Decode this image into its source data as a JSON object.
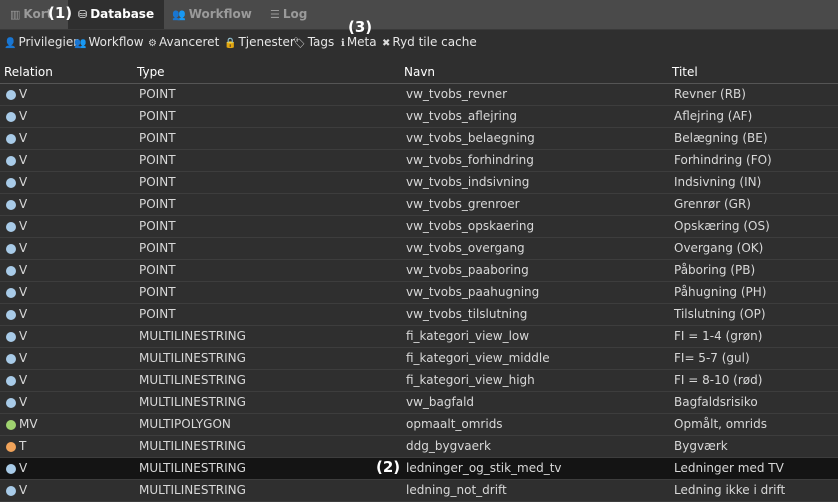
{
  "tabs": [
    {
      "label": "Kort",
      "icon": "map-icon",
      "active": false
    },
    {
      "label": "Database",
      "icon": "database-icon",
      "active": true
    },
    {
      "label": "Workflow",
      "icon": "users-icon",
      "active": false
    },
    {
      "label": "Log",
      "icon": "list-icon",
      "active": false
    }
  ],
  "annotations": {
    "a1": "(1)",
    "a2": "(2)",
    "a3": "(3)"
  },
  "toolbar": [
    {
      "label": "Privilegier",
      "icon": "user-icon"
    },
    {
      "label": "Workflow",
      "icon": "users-icon"
    },
    {
      "label": "Avanceret",
      "icon": "cogs-icon"
    },
    {
      "label": "Tjenester",
      "icon": "lock-icon"
    },
    {
      "label": "Tags",
      "icon": "tags-icon"
    },
    {
      "label": "Meta",
      "icon": "info-icon"
    },
    {
      "label": "Ryd tile cache",
      "icon": "close-icon"
    }
  ],
  "columns": [
    "Relation",
    "Type",
    "Navn",
    "Titel"
  ],
  "colors": {
    "view": "#a8cbe8",
    "materialized_view": "#9fd36f",
    "table": "#f0a35a"
  },
  "rows": [
    {
      "relation": "V",
      "dot": "view",
      "type": "POINT",
      "navn": "vw_tvobs_revner",
      "titel": "Revner (RB)"
    },
    {
      "relation": "V",
      "dot": "view",
      "type": "POINT",
      "navn": "vw_tvobs_aflejring",
      "titel": "Aflejring (AF)"
    },
    {
      "relation": "V",
      "dot": "view",
      "type": "POINT",
      "navn": "vw_tvobs_belaegning",
      "titel": "Belægning (BE)"
    },
    {
      "relation": "V",
      "dot": "view",
      "type": "POINT",
      "navn": "vw_tvobs_forhindring",
      "titel": "Forhindring (FO)"
    },
    {
      "relation": "V",
      "dot": "view",
      "type": "POINT",
      "navn": "vw_tvobs_indsivning",
      "titel": "Indsivning (IN)"
    },
    {
      "relation": "V",
      "dot": "view",
      "type": "POINT",
      "navn": "vw_tvobs_grenroer",
      "titel": "Grenrør (GR)"
    },
    {
      "relation": "V",
      "dot": "view",
      "type": "POINT",
      "navn": "vw_tvobs_opskaering",
      "titel": "Opskæring (OS)"
    },
    {
      "relation": "V",
      "dot": "view",
      "type": "POINT",
      "navn": "vw_tvobs_overgang",
      "titel": "Overgang (OK)"
    },
    {
      "relation": "V",
      "dot": "view",
      "type": "POINT",
      "navn": "vw_tvobs_paaboring",
      "titel": "Påboring (PB)"
    },
    {
      "relation": "V",
      "dot": "view",
      "type": "POINT",
      "navn": "vw_tvobs_paahugning",
      "titel": "Påhugning (PH)"
    },
    {
      "relation": "V",
      "dot": "view",
      "type": "POINT",
      "navn": "vw_tvobs_tilslutning",
      "titel": "Tilslutning (OP)"
    },
    {
      "relation": "V",
      "dot": "view",
      "type": "MULTILINESTRING",
      "navn": "fi_kategori_view_low",
      "titel": "FI = 1-4 (grøn)"
    },
    {
      "relation": "V",
      "dot": "view",
      "type": "MULTILINESTRING",
      "navn": "fi_kategori_view_middle",
      "titel": "FI= 5-7 (gul)"
    },
    {
      "relation": "V",
      "dot": "view",
      "type": "MULTILINESTRING",
      "navn": "fi_kategori_view_high",
      "titel": "FI = 8-10 (rød)"
    },
    {
      "relation": "V",
      "dot": "view",
      "type": "MULTILINESTRING",
      "navn": "vw_bagfald",
      "titel": "Bagfaldsrisiko"
    },
    {
      "relation": "MV",
      "dot": "materialized_view",
      "type": "MULTIPOLYGON",
      "navn": "opmaalt_omrids",
      "titel": "Opmålt, omrids"
    },
    {
      "relation": "T",
      "dot": "table",
      "type": "MULTILINESTRING",
      "navn": "ddg_bygvaerk",
      "titel": "Bygværk"
    },
    {
      "relation": "V",
      "dot": "view",
      "type": "MULTILINESTRING",
      "navn": "ledninger_og_stik_med_tv",
      "titel": "Ledninger med TV",
      "selected": true
    },
    {
      "relation": "V",
      "dot": "view",
      "type": "MULTILINESTRING",
      "navn": "ledning_not_drift",
      "titel": "Ledning ikke i drift"
    }
  ]
}
